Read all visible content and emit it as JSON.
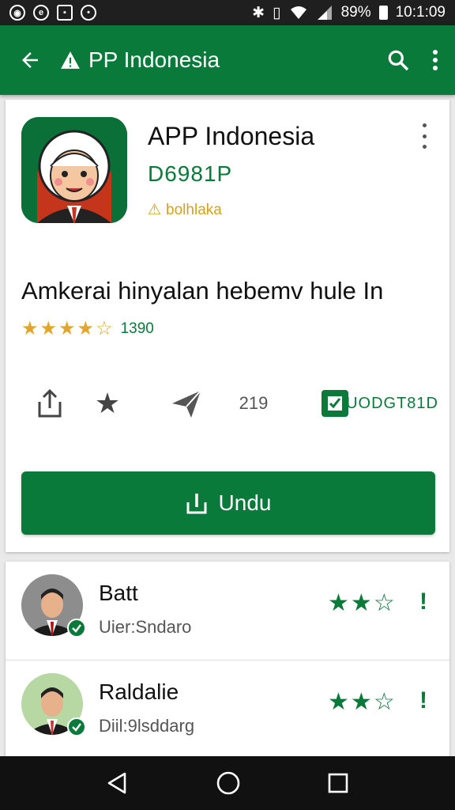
{
  "status_bar": {
    "battery": "89%",
    "time": "10:1:09",
    "left_icons": [
      "notification-icon",
      "chat-icon",
      "news-icon",
      "message-icon"
    ]
  },
  "app_bar": {
    "title": "PP Indonesia",
    "background": "#0a7a3a"
  },
  "app": {
    "name": "APP Indonesia",
    "developer": "D6981P",
    "badge": "bolhlaka",
    "description": "Amkerai hinyalan hebemv hule In",
    "rating_stars": 4.5,
    "rating_count": "1390",
    "actions": {
      "count": "219",
      "installed_label": "UODGT81D"
    },
    "download_label": "Undu"
  },
  "reviews": [
    {
      "name": "Batt",
      "subtitle": "Uier:Sndaro",
      "stars": 2,
      "flag": "!"
    },
    {
      "name": "Raldalie",
      "subtitle": "Diil:9lsddarg",
      "stars": 2,
      "flag": "!"
    }
  ],
  "colors": {
    "accent": "#0a7a3a",
    "star_gold": "#e3a52a",
    "badge": "#d8a11a"
  }
}
